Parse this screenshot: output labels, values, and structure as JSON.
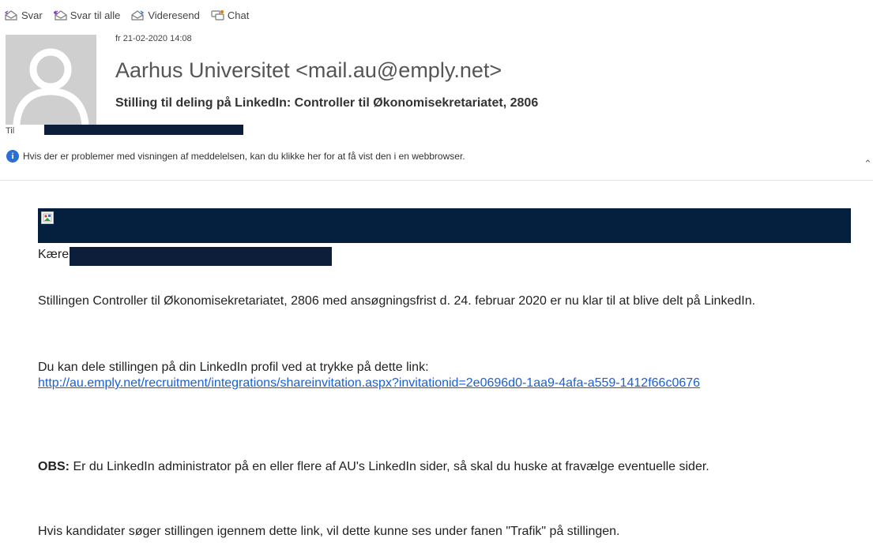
{
  "toolbar": {
    "reply": "Svar",
    "reply_all": "Svar til alle",
    "forward": "Videresend",
    "chat": "Chat"
  },
  "message": {
    "date": "fr 21-02-2020 14:08",
    "sender": "Aarhus Universitet <mail.au@emply.net>",
    "subject": "Stilling til deling på LinkedIn: Controller til Økonomisekretariatet, 2806",
    "to_label": "Til",
    "info_text": "Hvis der er problemer med visningen af meddelelsen, kan du klikke her for at få vist den i en webbrowser."
  },
  "body": {
    "greeting": "Kære",
    "p1": "Stillingen Controller til Økonomisekretariatet, 2806 med ansøgningsfrist d. 24. februar 2020 er nu klar til at blive delt på LinkedIn.",
    "p2_text": "Du kan dele stillingen på din LinkedIn profil ved at trykke på dette link:",
    "p2_link": "http://au.emply.net/recruitment/integrations/shareinvitation.aspx?invitationid=2e0696d0-1aa9-4afa-a559-1412f66c0676",
    "p3_bold": "OBS:",
    "p3_text": " Er du LinkedIn administrator på en eller flere af AU's LinkedIn sider, så skal du huske at fravælge eventuelle sider.",
    "p4": "Hvis kandidater søger stillingen igennem dette link, vil dette kunne ses under fanen \"Trafik\" på stillingen."
  },
  "colors": {
    "banner": "#05203f",
    "redaction": "#0c1e3a",
    "link": "#1a5fd6",
    "info": "#2a6fd6"
  }
}
